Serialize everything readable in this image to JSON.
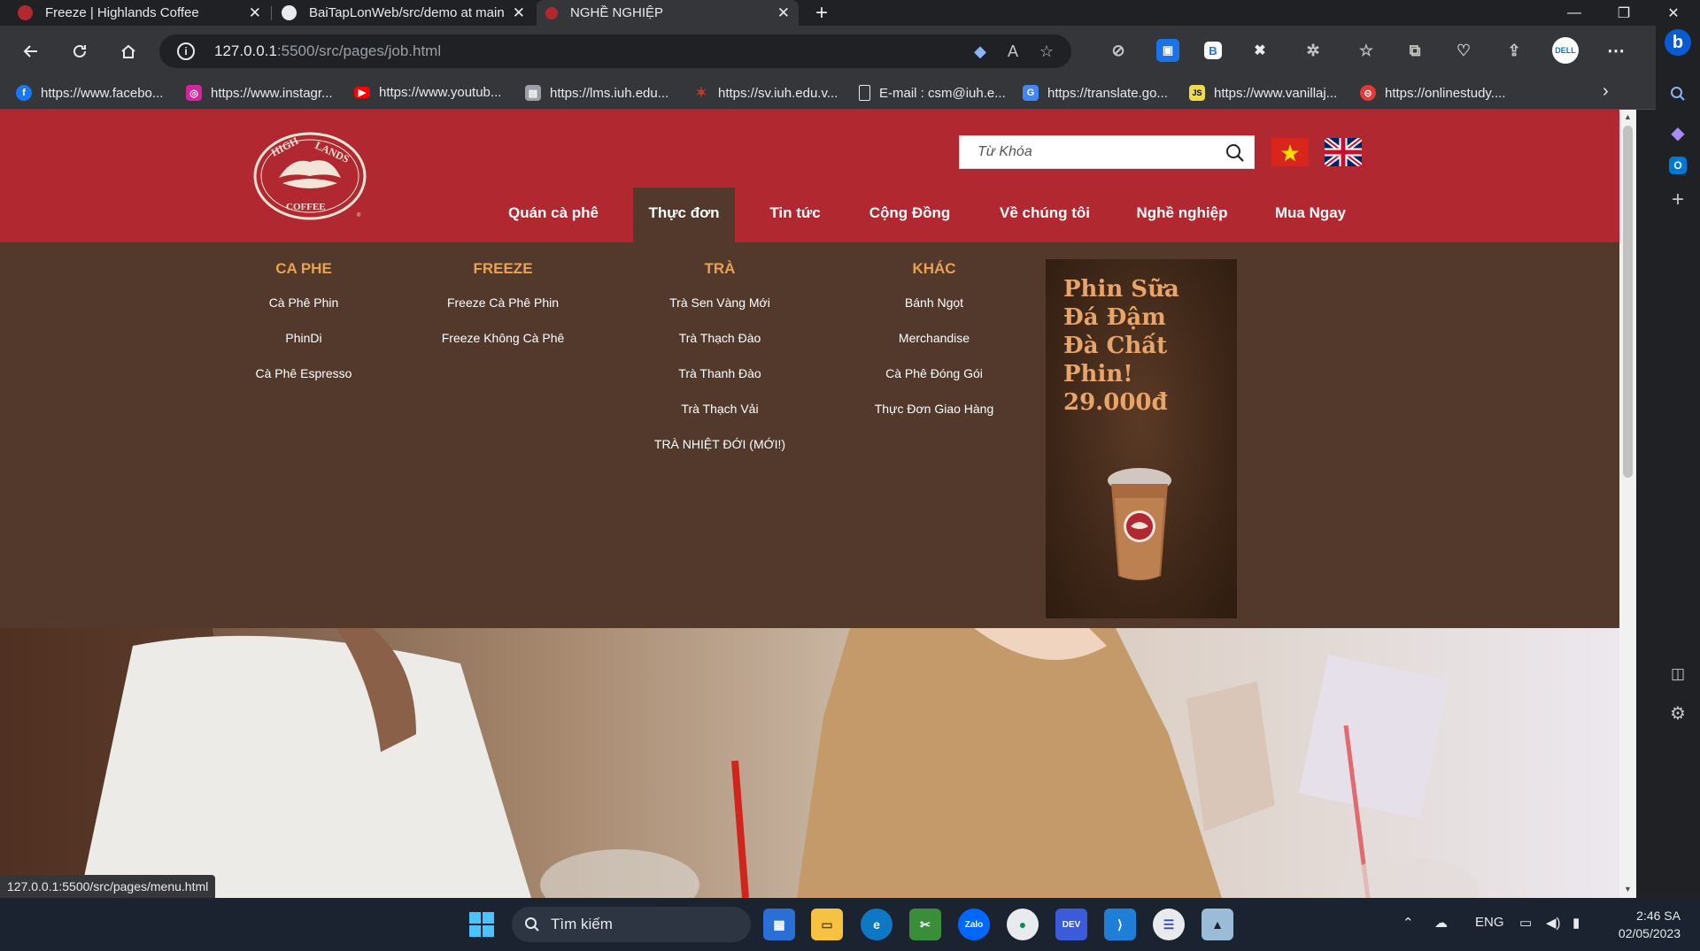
{
  "browser": {
    "tabs": [
      {
        "title": "Freeze | Highlands Coffee",
        "icon": "highlands-favicon",
        "close": "✕"
      },
      {
        "title": "BaiTapLonWeb/src/demo at main",
        "icon": "github-favicon",
        "close": "✕"
      },
      {
        "title": "NGHỀ NGHIỆP",
        "icon": "highlands-favicon",
        "close": "✕"
      }
    ],
    "new_tab": "+",
    "window_controls": {
      "minimize": "—",
      "maximize": "❐",
      "close": "✕"
    },
    "url_host": "127.0.0.1",
    "url_path": ":5500/src/pages/job.html",
    "bookmarks": [
      {
        "label": "https://www.facebo...",
        "icon": "facebook-icon",
        "color": "#1877f2",
        "glyph": "f"
      },
      {
        "label": "https://www.instagr...",
        "icon": "instagram-icon",
        "color": "#d6249f",
        "glyph": "◎"
      },
      {
        "label": "https://www.youtub...",
        "icon": "youtube-icon",
        "color": "#ff0000",
        "glyph": "▶"
      },
      {
        "label": "https://lms.iuh.edu...",
        "icon": "lms-icon",
        "color": "#9aa0a6",
        "glyph": "▤"
      },
      {
        "label": "https://sv.iuh.edu.v...",
        "icon": "iuh-icon",
        "color": "#c0392b",
        "glyph": "✶"
      },
      {
        "label": "E-mail : csm@iuh.e...",
        "icon": "document-icon",
        "color": "#35363a",
        "glyph": "▯"
      },
      {
        "label": "https://translate.go...",
        "icon": "translate-icon",
        "color": "#4285f4",
        "glyph": "G"
      },
      {
        "label": "https://www.vanillaj...",
        "icon": "vanillajs-icon",
        "color": "#f0db4f",
        "glyph": "JS"
      },
      {
        "label": "https://onlinestudy....",
        "icon": "onlinestudy-icon",
        "color": "#e53935",
        "glyph": "⊖"
      }
    ],
    "status_url": "127.0.0.1:5500/src/pages/menu.html"
  },
  "site": {
    "search_placeholder": "Từ Khóa",
    "nav": [
      {
        "label": "Quán cà phê"
      },
      {
        "label": "Thực đơn"
      },
      {
        "label": "Tin tức"
      },
      {
        "label": "Cộng Đồng"
      },
      {
        "label": "Về chúng tôi"
      },
      {
        "label": "Nghề nghiệp"
      },
      {
        "label": "Mua Ngay"
      }
    ],
    "menu": {
      "ca_phe": {
        "heading": "CA PHE",
        "items": [
          "Cà Phê Phin",
          "PhinDi",
          "Cà Phê Espresso"
        ]
      },
      "freeze": {
        "heading": "FREEZE",
        "items": [
          "Freeze Cà Phê Phin",
          "Freeze Không Cà Phê"
        ]
      },
      "tra": {
        "heading": "TRÀ",
        "items": [
          "Trà Sen Vàng Mới",
          "Trà Thạch Đào",
          "Trà Thanh Đào",
          "Trà Thạch Vải",
          "TRÀ NHIỆT ĐỚI (MỚI!)"
        ]
      },
      "khac": {
        "heading": "KHÁC",
        "items": [
          "Bánh Ngọt",
          "Merchandise",
          "Cà Phê Đóng Gói",
          "Thực Đơn Giao Hàng"
        ]
      }
    },
    "promo": {
      "line1": "Phin Sữa",
      "line2": "Đá Đậm",
      "line3": "Đà Chất",
      "line4": "Phin!",
      "price": "29.000đ"
    },
    "colors": {
      "header_red": "#b22830",
      "menu_brown": "#53382c",
      "menu_heading": "#e8a254"
    }
  },
  "taskbar": {
    "search_label": "Tìm kiếm",
    "lang": "ENG",
    "time": "2:46 SA",
    "date": "02/05/2023"
  }
}
